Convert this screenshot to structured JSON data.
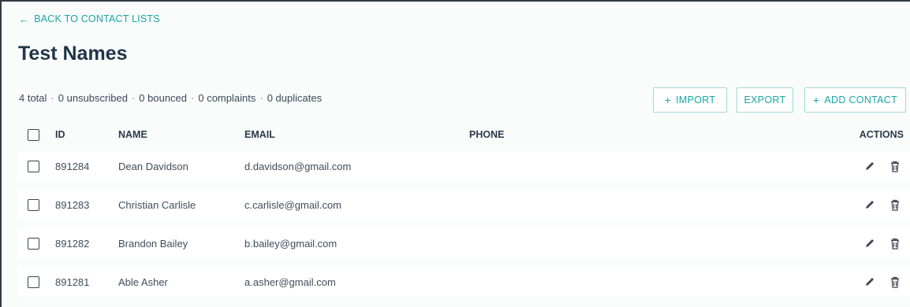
{
  "nav": {
    "back_label": "BACK TO CONTACT LISTS"
  },
  "page": {
    "title": "Test Names"
  },
  "stats": {
    "total": "4 total",
    "unsubscribed": "0 unsubscribed",
    "bounced": "0 bounced",
    "complaints": "0 complaints",
    "duplicates": "0 duplicates",
    "separator": "·"
  },
  "toolbar": {
    "import_label": "IMPORT",
    "export_label": "EXPORT",
    "add_label": "ADD CONTACT"
  },
  "table": {
    "headers": {
      "id": "ID",
      "name": "NAME",
      "email": "EMAIL",
      "phone": "PHONE",
      "actions": "ACTIONS"
    },
    "rows": [
      {
        "id": "891284",
        "name": "Dean Davidson",
        "email": "d.davidson@gmail.com",
        "phone": ""
      },
      {
        "id": "891283",
        "name": "Christian Carlisle",
        "email": "c.carlisle@gmail.com",
        "phone": ""
      },
      {
        "id": "891282",
        "name": "Brandon Bailey",
        "email": "b.bailey@gmail.com",
        "phone": ""
      },
      {
        "id": "891281",
        "name": "Able Asher",
        "email": "a.asher@gmail.com",
        "phone": ""
      }
    ]
  },
  "icons": {
    "back": "arrow-left-icon",
    "plus": "plus-icon",
    "edit": "pencil-icon",
    "delete": "trash-icon"
  },
  "colors": {
    "accent": "#1aa5a5",
    "title": "#1f3447",
    "text": "#3f4d5b"
  }
}
